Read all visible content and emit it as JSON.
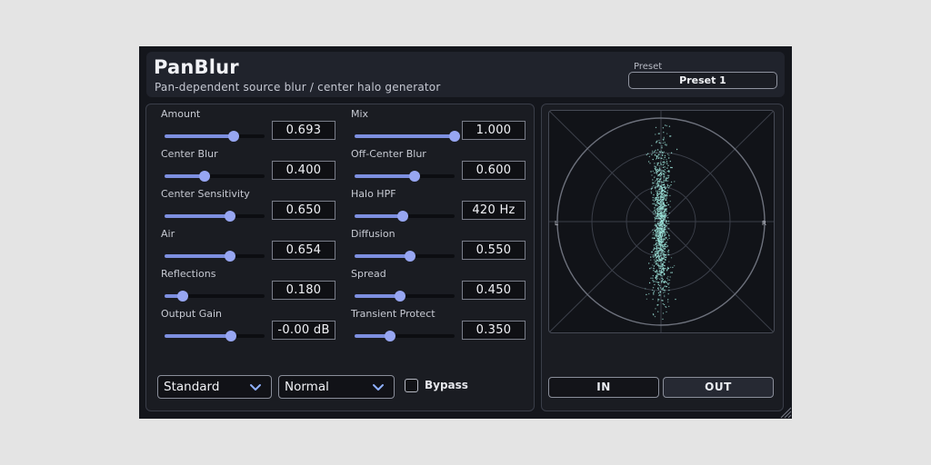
{
  "header": {
    "title": "PanBlur",
    "subtitle": "Pan-dependent source blur / center halo generator",
    "preset_label": "Preset",
    "preset_value": "Preset 1"
  },
  "left_params": [
    {
      "label": "Amount",
      "value": "0.693",
      "position": 0.693
    },
    {
      "label": "Center Blur",
      "value": "0.400",
      "position": 0.4
    },
    {
      "label": "Center Sensitivity",
      "value": "0.650",
      "position": 0.65
    },
    {
      "label": "Air",
      "value": "0.654",
      "position": 0.654
    },
    {
      "label": "Reflections",
      "value": "0.180",
      "position": 0.18
    },
    {
      "label": "Output Gain",
      "value": "-0.00 dB",
      "position": 0.66
    }
  ],
  "right_params": [
    {
      "label": "Mix",
      "value": "1.000",
      "position": 1.0
    },
    {
      "label": "Off-Center Blur",
      "value": "0.600",
      "position": 0.6
    },
    {
      "label": "Halo HPF",
      "value": "420 Hz",
      "position": 0.48
    },
    {
      "label": "Diffusion",
      "value": "0.550",
      "position": 0.55
    },
    {
      "label": "Spread",
      "value": "0.450",
      "position": 0.45
    },
    {
      "label": "Transient Protect",
      "value": "0.350",
      "position": 0.35
    }
  ],
  "footer": {
    "mode_dropdown": "Standard",
    "quality_dropdown": "Normal",
    "bypass_label": "Bypass",
    "bypass_checked": false
  },
  "scope": {
    "left_label": "L",
    "right_label": "R",
    "in_button": "IN",
    "out_button": "OUT",
    "active_button": "OUT",
    "dot_color": "#9ee6dc"
  },
  "colors": {
    "accent": "#97a6f2",
    "background": "#14161c",
    "panel": "#1a1c22"
  }
}
